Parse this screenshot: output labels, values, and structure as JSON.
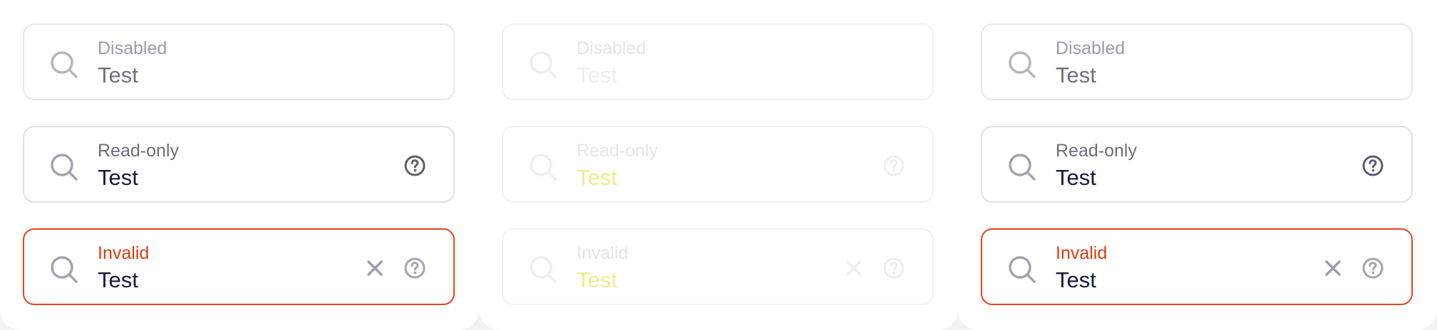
{
  "panels": [
    {
      "fields": [
        {
          "label": "Disabled",
          "value": "Test",
          "icons": [
            "search-icon"
          ]
        },
        {
          "label": "Read-only",
          "value": "Test",
          "icons": [
            "search-icon",
            "help-icon"
          ]
        },
        {
          "label": "Invalid",
          "value": "Test",
          "icons": [
            "search-icon",
            "clear-icon",
            "help-icon"
          ]
        }
      ]
    },
    {
      "fields": [
        {
          "label": "Disabled",
          "value": "Test",
          "icons": [
            "search-icon"
          ]
        },
        {
          "label": "Read-only",
          "value": "Test",
          "icons": [
            "search-icon",
            "help-icon"
          ]
        },
        {
          "label": "Invalid",
          "value": "Test",
          "icons": [
            "search-icon",
            "clear-icon",
            "help-icon"
          ]
        }
      ]
    },
    {
      "fields": [
        {
          "label": "Disabled",
          "value": "Test",
          "icons": [
            "search-icon"
          ]
        },
        {
          "label": "Read-only",
          "value": "Test",
          "icons": [
            "search-icon",
            "help-icon"
          ]
        },
        {
          "label": "Invalid",
          "value": "Test",
          "icons": [
            "search-icon",
            "clear-icon",
            "help-icon"
          ]
        }
      ]
    }
  ],
  "colors": {
    "border": "#dfe0e6",
    "invalid_border": "#e8441e",
    "invalid_label": "#d93b12",
    "text": "#141a38",
    "muted": "#6b6e7d",
    "icon": "#a2a4b1"
  }
}
